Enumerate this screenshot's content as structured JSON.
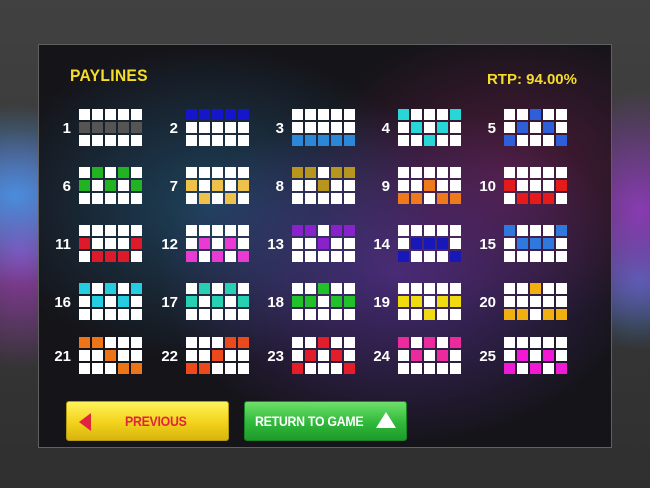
{
  "header": {
    "title": "PAYLINES",
    "rtp": "RTP: 94.00%"
  },
  "buttons": {
    "previous": "PREVIOUS",
    "return_to_game": "RETURN TO GAME"
  },
  "paylines": [
    {
      "number": "1",
      "color": "#555555",
      "cells": [
        1,
        1,
        1,
        1,
        1
      ]
    },
    {
      "number": "2",
      "color": "#1515cc",
      "cells": [
        0,
        0,
        0,
        0,
        0
      ]
    },
    {
      "number": "3",
      "color": "#2b87d8",
      "cells": [
        2,
        2,
        2,
        2,
        2
      ]
    },
    {
      "number": "4",
      "color": "#27d6d6",
      "cells": [
        0,
        1,
        2,
        1,
        0
      ]
    },
    {
      "number": "5",
      "color": "#2f5fd8",
      "cells": [
        2,
        1,
        0,
        1,
        2
      ]
    },
    {
      "number": "6",
      "color": "#22b322",
      "cells": [
        1,
        0,
        1,
        0,
        1
      ]
    },
    {
      "number": "7",
      "color": "#eec24a",
      "cells": [
        1,
        2,
        1,
        2,
        1
      ]
    },
    {
      "number": "8",
      "color": "#b8961e",
      "cells": [
        0,
        0,
        1,
        0,
        0
      ]
    },
    {
      "number": "9",
      "color": "#ee7a1c",
      "cells": [
        2,
        2,
        1,
        2,
        2
      ]
    },
    {
      "number": "10",
      "color": "#e31b1b",
      "cells": [
        1,
        2,
        2,
        2,
        1
      ]
    },
    {
      "number": "11",
      "color": "#dd1a2a",
      "cells": [
        1,
        2,
        2,
        2,
        1
      ]
    },
    {
      "number": "12",
      "color": "#ea3ad4",
      "cells": [
        2,
        1,
        2,
        1,
        2
      ]
    },
    {
      "number": "13",
      "color": "#8a22cc",
      "cells": [
        0,
        0,
        1,
        0,
        0
      ]
    },
    {
      "number": "14",
      "color": "#1818b8",
      "cells": [
        2,
        1,
        1,
        1,
        2
      ]
    },
    {
      "number": "15",
      "color": "#2e78de",
      "cells": [
        0,
        1,
        1,
        1,
        0
      ]
    },
    {
      "number": "16",
      "color": "#25cde0",
      "cells": [
        0,
        1,
        0,
        1,
        0
      ]
    },
    {
      "number": "17",
      "color": "#27d0b0",
      "cells": [
        1,
        0,
        1,
        0,
        1
      ]
    },
    {
      "number": "18",
      "color": "#21c229",
      "cells": [
        1,
        1,
        0,
        1,
        1
      ]
    },
    {
      "number": "19",
      "color": "#eedc10",
      "cells": [
        1,
        1,
        2,
        1,
        1
      ]
    },
    {
      "number": "20",
      "color": "#f0b010",
      "cells": [
        2,
        2,
        0,
        2,
        2
      ]
    },
    {
      "number": "21",
      "color": "#ee7418",
      "cells": [
        0,
        0,
        1,
        2,
        2
      ]
    },
    {
      "number": "22",
      "color": "#ec4a1c",
      "cells": [
        2,
        2,
        1,
        0,
        0
      ]
    },
    {
      "number": "23",
      "color": "#e31d2a",
      "cells": [
        2,
        1,
        0,
        1,
        2
      ]
    },
    {
      "number": "24",
      "color": "#ec2a9c",
      "cells": [
        0,
        1,
        0,
        1,
        0
      ]
    },
    {
      "number": "25",
      "color": "#f01ad4",
      "cells": [
        2,
        1,
        2,
        1,
        2
      ]
    }
  ]
}
